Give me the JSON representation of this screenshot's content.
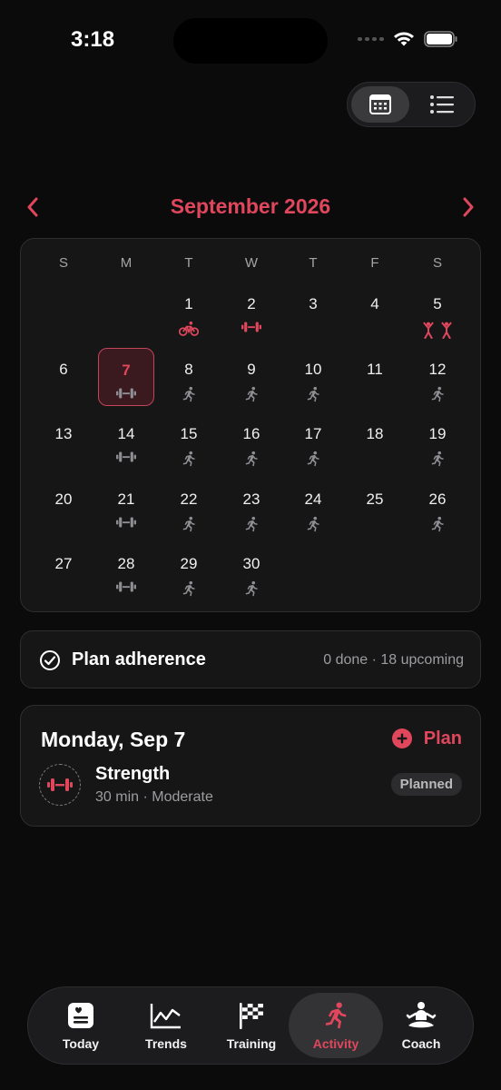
{
  "status_bar": {
    "time": "3:18"
  },
  "calendar": {
    "month_title": "September 2026",
    "weekdays": [
      "S",
      "M",
      "T",
      "W",
      "T",
      "F",
      "S"
    ],
    "days": [
      {
        "label": "1",
        "icon": "bike-icon"
      },
      {
        "label": "2",
        "icon": "dumbbell-icon"
      },
      {
        "label": "3",
        "icon": ""
      },
      {
        "label": "4",
        "icon": ""
      },
      {
        "label": "5",
        "icon": "stretch-icon"
      },
      {
        "label": "6",
        "icon": ""
      },
      {
        "label": "7",
        "icon": "dumbbell-icon",
        "selected": true
      },
      {
        "label": "8",
        "icon": "run-icon"
      },
      {
        "label": "9",
        "icon": "run-icon"
      },
      {
        "label": "10",
        "icon": "run-icon"
      },
      {
        "label": "11",
        "icon": ""
      },
      {
        "label": "12",
        "icon": "run-icon"
      },
      {
        "label": "13",
        "icon": ""
      },
      {
        "label": "14",
        "icon": "dumbbell-icon"
      },
      {
        "label": "15",
        "icon": "run-icon"
      },
      {
        "label": "16",
        "icon": "run-icon"
      },
      {
        "label": "17",
        "icon": "run-icon"
      },
      {
        "label": "18",
        "icon": ""
      },
      {
        "label": "19",
        "icon": "run-icon"
      },
      {
        "label": "20",
        "icon": ""
      },
      {
        "label": "21",
        "icon": "dumbbell-icon"
      },
      {
        "label": "22",
        "icon": "run-icon"
      },
      {
        "label": "23",
        "icon": "run-icon"
      },
      {
        "label": "24",
        "icon": "run-icon"
      },
      {
        "label": "25",
        "icon": ""
      },
      {
        "label": "26",
        "icon": "run-icon"
      },
      {
        "label": "27",
        "icon": ""
      },
      {
        "label": "28",
        "icon": "dumbbell-icon"
      },
      {
        "label": "29",
        "icon": "run-icon"
      },
      {
        "label": "30",
        "icon": "run-icon"
      }
    ]
  },
  "adherence": {
    "label": "Plan adherence",
    "stats": "0 done · 18 upcoming"
  },
  "day_detail": {
    "title": "Monday, Sep 7",
    "plan_label": "Plan",
    "workout": {
      "name": "Strength",
      "meta": "30 min · Moderate",
      "status": "Planned",
      "icon": "dumbbell-icon"
    }
  },
  "tabs": [
    {
      "label": "Today",
      "icon": "today-icon"
    },
    {
      "label": "Trends",
      "icon": "trends-icon"
    },
    {
      "label": "Training",
      "icon": "flag-icon"
    },
    {
      "label": "Activity",
      "icon": "run-icon",
      "active": true
    },
    {
      "label": "Coach",
      "icon": "meditate-icon"
    }
  ],
  "colors": {
    "accent": "#e0475d",
    "background": "#0b0b0c",
    "card": "#161617"
  }
}
